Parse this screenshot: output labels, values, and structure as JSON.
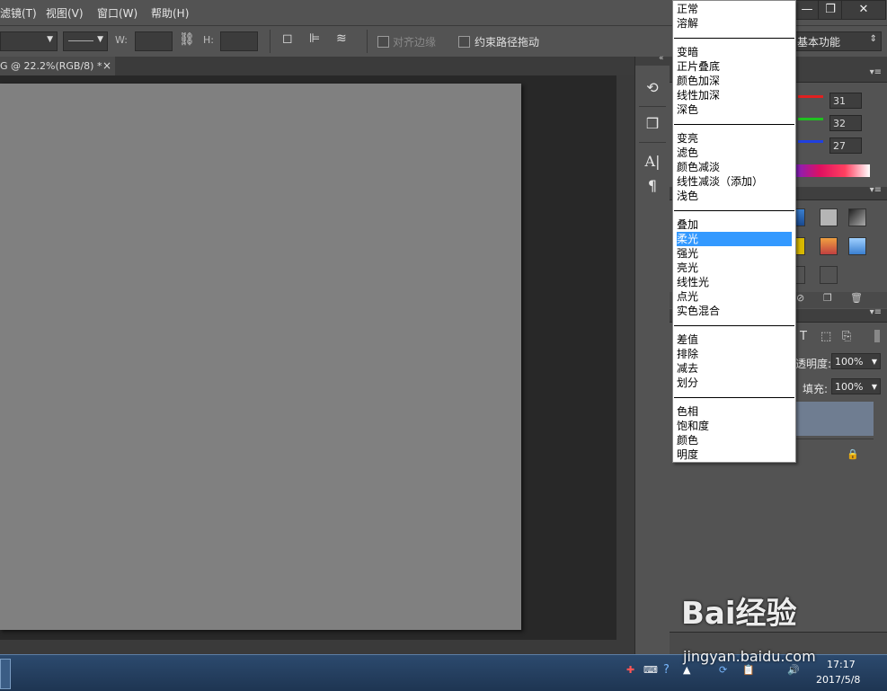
{
  "menubar": {
    "items": [
      "滤镜(T)",
      "视图(V)",
      "窗口(W)",
      "帮助(H)"
    ]
  },
  "options_bar": {
    "w_label": "W:",
    "h_label": "H:",
    "align_edges_label": "对齐边缘",
    "constrain_path_label": "约束路径拖动",
    "workspace_label": "基本功能"
  },
  "document": {
    "tab_title": "G @ 22.2%(RGB/8) *",
    "close_glyph": "×"
  },
  "window_controls": {
    "minimize": "—",
    "restore": "❐",
    "close": "✕"
  },
  "color_panel": {
    "r": "31",
    "g": "32",
    "b": "27"
  },
  "layers_panel": {
    "opacity_label": "透明度:",
    "opacity_value": "100%",
    "fill_label": "填充:",
    "fill_value": "100%"
  },
  "blend_menu": {
    "groups": [
      [
        "正常",
        "溶解"
      ],
      [
        "变暗",
        "正片叠底",
        "颜色加深",
        "线性加深",
        "深色"
      ],
      [
        "变亮",
        "滤色",
        "颜色减淡",
        "线性减淡（添加）",
        "浅色"
      ],
      [
        "叠加",
        "柔光",
        "强光",
        "亮光",
        "线性光",
        "点光",
        "实色混合"
      ],
      [
        "差值",
        "排除",
        "减去",
        "划分"
      ],
      [
        "色相",
        "饱和度",
        "颜色",
        "明度"
      ]
    ],
    "selected": "柔光"
  },
  "taskbar": {
    "time": "17:17",
    "date": "2017/5/8"
  },
  "watermark": {
    "brand": "Bai经验",
    "url": "jingyan.baidu.com"
  },
  "colors": {
    "ui_gray": "#535353",
    "canvas_gray": "#808080",
    "selection_blue": "#3399ff",
    "layer_selected": "#6f7d91"
  }
}
